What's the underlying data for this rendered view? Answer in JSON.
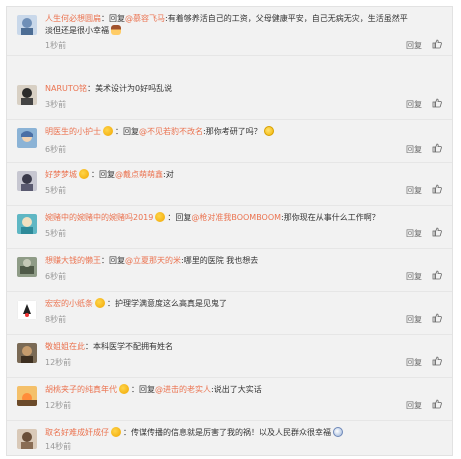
{
  "reply_label": "回复",
  "comments": [
    {
      "user": "人生何必想圆扁",
      "sep": "：",
      "prefix": "回复",
      "mention": "@慕容飞马",
      "text": ":有着够养活自己的工资，父母健康平安，自己无病无灾，生活虽然平淡但还是很小幸福",
      "emoji": "e-hat",
      "time": "1秒前"
    },
    {
      "user": "NARUTO铭",
      "sep": "：",
      "prefix": "",
      "mention": "",
      "text": "美术设计为0好吗乱说",
      "emoji": "",
      "time": "3秒前"
    },
    {
      "user": "明医生的小护士",
      "sep": "：",
      "prefix": "回复",
      "mention": "@不见若豹不改名",
      "text": ":那你考研了吗？",
      "emoji": "e-smile",
      "time": "6秒前"
    },
    {
      "user": "好梦梦城",
      "sep": "：",
      "prefix": "回复",
      "mention": "@戴点萌萌鑫",
      "text": ":对",
      "emoji": "",
      "time": "5秒前"
    },
    {
      "user": "婉赌中的婉赌中的婉赌吗2019",
      "sep": "：",
      "prefix": "回复",
      "mention": "@枪对准我BOOMBOOM",
      "text": ":那你现在从事什么工作啊？",
      "emoji": "",
      "time": "5秒前"
    },
    {
      "user": "想赚大钱的懒王",
      "sep": "：",
      "prefix": "回复",
      "mention": "@立夏那天的米",
      "text": ":哪里的医院 我也想去",
      "emoji": "",
      "time": "6秒前"
    },
    {
      "user": "宏宏的小纸条",
      "sep": "：",
      "prefix": "",
      "mention": "",
      "text": "护理学满意度这么高真是见鬼了",
      "emoji": "",
      "time": "8秒前"
    },
    {
      "user": "敬姐姐在此",
      "sep": "：",
      "prefix": "",
      "mention": "",
      "text": "本科医学不配拥有姓名",
      "emoji": "",
      "time": "12秒前"
    },
    {
      "user": "胡桃夹子的纯真年代",
      "sep": "：",
      "prefix": "回复",
      "mention": "@进击的老实人",
      "text": ":说出了大实话",
      "emoji": "",
      "time": "12秒前"
    },
    {
      "user": "取名好难成奸成仔",
      "sep": "：",
      "prefix": "",
      "mention": "",
      "text": "传谋传播的信息就是厉害了我的祸！以及人民群众很幸福",
      "emoji": "e-shock",
      "time": "14秒前"
    }
  ],
  "user_emoji": "e-mad",
  "colors": {
    "username": "#eb7350",
    "timestamp": "#999999",
    "panel_bg": "#f2f2f2"
  }
}
